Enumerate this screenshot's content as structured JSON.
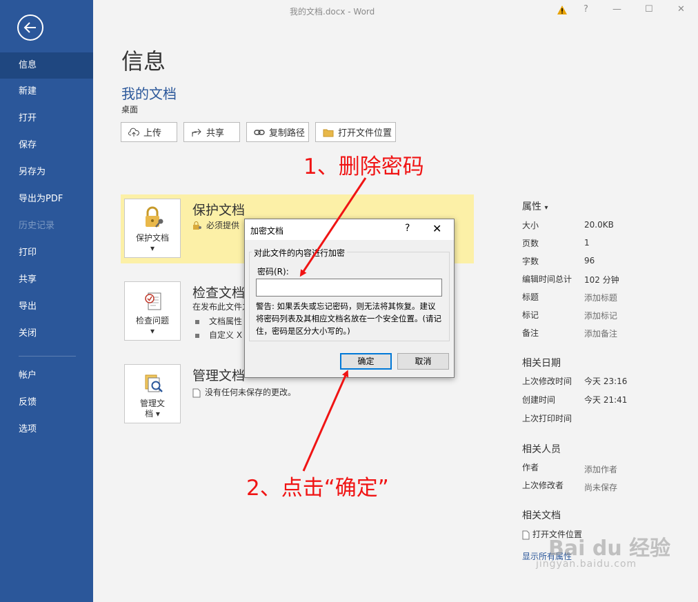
{
  "window": {
    "title": "我的文档.docx - Word",
    "help": "?",
    "minimize": "—",
    "restore": "☐",
    "close": "✕"
  },
  "sidebar": {
    "items": [
      {
        "label": "信息",
        "state": "active"
      },
      {
        "label": "新建"
      },
      {
        "label": "打开"
      },
      {
        "label": "保存"
      },
      {
        "label": "另存为"
      },
      {
        "label": "导出为PDF"
      },
      {
        "label": "历史记录",
        "state": "disabled"
      },
      {
        "label": "打印"
      },
      {
        "label": "共享"
      },
      {
        "label": "导出"
      },
      {
        "label": "关闭"
      },
      {
        "label": "帐户"
      },
      {
        "label": "反馈"
      },
      {
        "label": "选项"
      }
    ]
  },
  "main": {
    "title": "信息",
    "doc_name": "我的文档",
    "doc_location": "桌面",
    "toolbar": {
      "upload": "上传",
      "share": "共享",
      "copy_path": "复制路径",
      "open_location": "打开文件位置"
    },
    "protect": {
      "button_label": "保护文档",
      "title": "保护文档",
      "desc": "必须提供"
    },
    "inspect": {
      "button_label": "检查问题",
      "title": "检查文档",
      "desc": "在发布此文件之",
      "bullet1": "文档属性",
      "bullet2": "自定义 X"
    },
    "manage": {
      "button_label_1": "管理文",
      "button_label_2": "档",
      "title": "管理文档",
      "desc": "没有任何未保存的更改。"
    }
  },
  "properties": {
    "header": "属性",
    "rows": [
      {
        "k": "大小",
        "v": "20.0KB"
      },
      {
        "k": "页数",
        "v": "1"
      },
      {
        "k": "字数",
        "v": "96"
      },
      {
        "k": "编辑时间总计",
        "v": "102 分钟"
      },
      {
        "k": "标题",
        "v": "添加标题"
      },
      {
        "k": "标记",
        "v": "添加标记"
      },
      {
        "k": "备注",
        "v": "添加备注"
      }
    ],
    "dates_header": "相关日期",
    "dates": [
      {
        "k": "上次修改时间",
        "v": "今天 23:16"
      },
      {
        "k": "创建时间",
        "v": "今天 21:41"
      },
      {
        "k": "上次打印时间",
        "v": ""
      }
    ],
    "people_header": "相关人员",
    "people": [
      {
        "k": "作者",
        "v": "添加作者"
      },
      {
        "k": "上次修改者",
        "v": "尚未保存"
      }
    ],
    "docs_header": "相关文档",
    "open_location": "打开文件位置",
    "show_more": "显示所有属性"
  },
  "dialog": {
    "title": "加密文档",
    "help": "?",
    "close": "✕",
    "group_label": "对此文件的内容进行加密",
    "password_label": "密码(R):",
    "password_value": "",
    "warning": "警告: 如果丢失或忘记密码，则无法将其恢复。建议将密码列表及其相应文档名放在一个安全位置。(请记住，密码是区分大小写的。)",
    "ok": "确定",
    "cancel": "取消"
  },
  "annotations": {
    "step1": "1、删除密码",
    "step2": "2、点击“确定”"
  },
  "watermark": {
    "top": "Bai du 经验",
    "bottom": "jingyan.baidu.com"
  },
  "colors": {
    "sidebar": "#2b579a",
    "accent": "#2b579a",
    "highlight": "#fcf0a7",
    "annotation": "#f01414"
  }
}
